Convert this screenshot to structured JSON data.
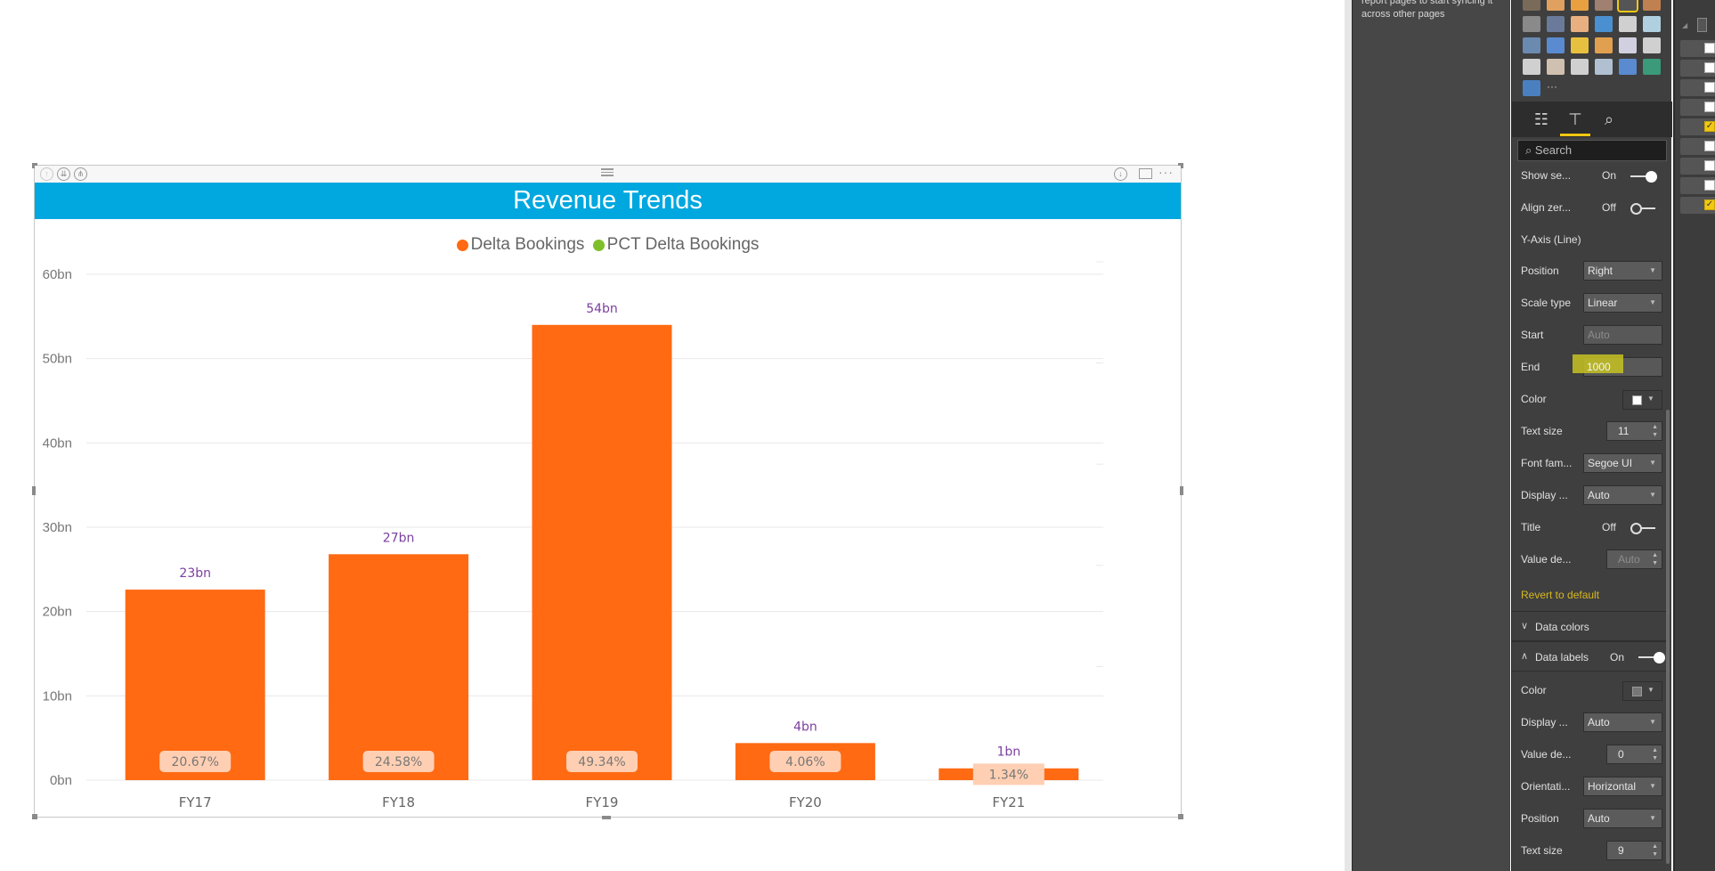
{
  "sync_pane": {
    "message": "report pages to start syncing it across other pages"
  },
  "visual": {
    "title": "Revenue Trends",
    "header_icons": [
      "drill-up-icon",
      "expand-all-down-icon",
      "drill-down-icon"
    ],
    "header_right_icons": [
      "drill-mode-icon",
      "focus-mode-icon",
      "more-options-icon"
    ],
    "legend": [
      {
        "label": "Delta Bookings",
        "color": "#ff6a13"
      },
      {
        "label": "PCT Delta Bookings",
        "color": "#7fbf2a"
      }
    ]
  },
  "chart_data": {
    "type": "bar",
    "title": "Revenue Trends",
    "categories": [
      "FY17",
      "FY18",
      "FY19",
      "FY20",
      "FY21"
    ],
    "series": [
      {
        "name": "Delta Bookings",
        "values": [
          22.6,
          26.8,
          54.0,
          4.4,
          1.4
        ],
        "labels": [
          "23bn",
          "27bn",
          "54bn",
          "4bn",
          "1bn"
        ],
        "color": "#ff6a13"
      },
      {
        "name": "PCT Delta Bookings",
        "values": [
          20.67,
          24.58,
          49.34,
          4.06,
          1.34
        ],
        "labels": [
          "20.67%",
          "24.58%",
          "49.34%",
          "4.06%",
          "1.34%"
        ],
        "color": "#7fbf2a"
      }
    ],
    "y_ticks": [
      "0bn",
      "10bn",
      "20bn",
      "30bn",
      "40bn",
      "50bn",
      "60bn"
    ],
    "y_tick_values": [
      0,
      10,
      20,
      30,
      40,
      50,
      60
    ],
    "ylim": [
      0,
      60
    ],
    "secondary_ylim": [
      0,
      1000
    ],
    "xlabel": "",
    "ylabel": "",
    "grid": true,
    "legend_position": "top-center",
    "value_label_color": "#7b3fa0"
  },
  "format_pane": {
    "search_placeholder": "Search",
    "tabs": [
      "fields-tab",
      "format-tab",
      "analytics-tab"
    ],
    "show_secondary": {
      "label": "Show se...",
      "state": "On"
    },
    "align_zeros": {
      "label": "Align zer...",
      "state": "Off"
    },
    "y_axis_line_heading": "Y-Axis (Line)",
    "position": {
      "label": "Position",
      "value": "Right"
    },
    "scale_type": {
      "label": "Scale type",
      "value": "Linear"
    },
    "start": {
      "label": "Start",
      "placeholder": "Auto"
    },
    "end": {
      "label": "End",
      "value": "1000"
    },
    "color": {
      "label": "Color",
      "swatch": "#ffffff"
    },
    "text_size": {
      "label": "Text size",
      "value": "11"
    },
    "font_family": {
      "label": "Font fam...",
      "value": "Segoe UI"
    },
    "display_units": {
      "label": "Display ...",
      "value": "Auto"
    },
    "title": {
      "label": "Title",
      "state": "Off"
    },
    "value_decimals": {
      "label": "Value de...",
      "placeholder": "Auto"
    },
    "revert": "Revert to default",
    "data_colors": "Data colors",
    "data_labels": {
      "label": "Data labels",
      "state": "On"
    },
    "dl_color": {
      "label": "Color",
      "swatch": "#777777"
    },
    "dl_display_units": {
      "label": "Display ...",
      "value": "Auto"
    },
    "dl_value_decimals": {
      "label": "Value de...",
      "value": "0"
    },
    "dl_orientation": {
      "label": "Orientati...",
      "value": "Horizontal"
    },
    "dl_position": {
      "label": "Position",
      "value": "Auto"
    },
    "dl_text_size": {
      "label": "Text size",
      "value": "9"
    }
  },
  "fields_pane": {
    "checkboxes": [
      false,
      false,
      false,
      false,
      true,
      false,
      false,
      false,
      true
    ]
  }
}
